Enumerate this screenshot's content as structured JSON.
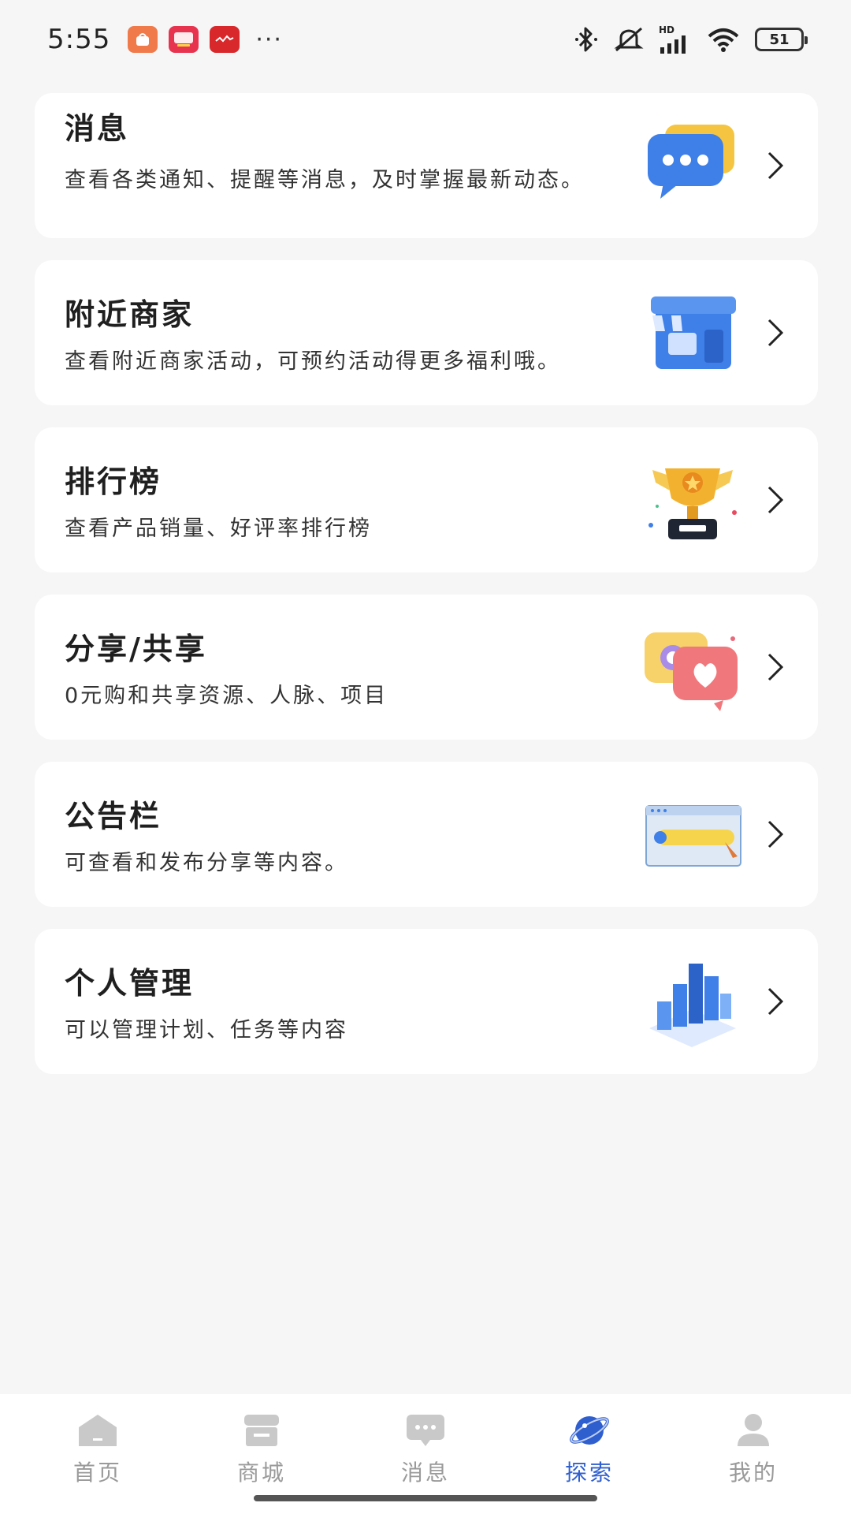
{
  "status_bar": {
    "time": "5:55",
    "notification_apps": [
      "shop-app-icon",
      "taobao-app-icon",
      "red-app-icon"
    ],
    "more": "···",
    "network_label": "HD",
    "battery": "51"
  },
  "cards": [
    {
      "title": "消息",
      "desc": "查看各类通知、提醒等消息，及时掌握最新动态。",
      "icon": "chat-bubble-illustration"
    },
    {
      "title": "附近商家",
      "desc": "查看附近商家活动，可预约活动得更多福利哦。",
      "icon": "storefront-illustration"
    },
    {
      "title": "排行榜",
      "desc": "查看产品销量、好评率排行榜",
      "icon": "trophy-illustration"
    },
    {
      "title": "分享/共享",
      "desc": "0元购和共享资源、人脉、项目",
      "icon": "share-heart-illustration"
    },
    {
      "title": "公告栏",
      "desc": "可查看和发布分享等内容。",
      "icon": "bulletin-board-illustration"
    },
    {
      "title": "个人管理",
      "desc": "可以管理计划、任务等内容",
      "icon": "bar-chart-illustration"
    }
  ],
  "bottom_nav": [
    {
      "label": "首页",
      "icon": "home-icon",
      "active": false
    },
    {
      "label": "商城",
      "icon": "store-icon",
      "active": false
    },
    {
      "label": "消息",
      "icon": "message-icon",
      "active": false
    },
    {
      "label": "探索",
      "icon": "explore-planet-icon",
      "active": true
    },
    {
      "label": "我的",
      "icon": "profile-icon",
      "active": false
    }
  ],
  "colors": {
    "background": "#f6f6f7",
    "card": "#ffffff",
    "accent": "#2f5fcf",
    "nav_inactive": "#9a9a9a"
  }
}
